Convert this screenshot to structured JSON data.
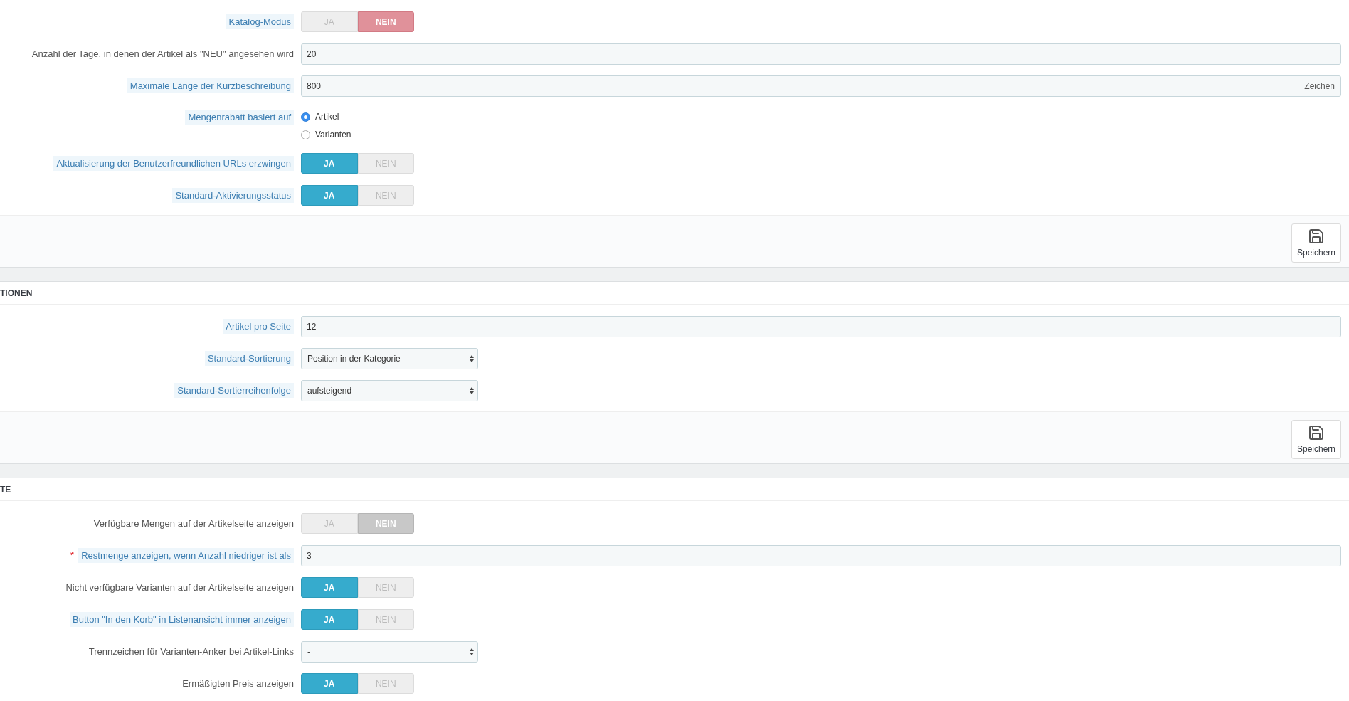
{
  "sections": [
    {
      "fields": [
        {
          "kind": "toggle",
          "label": "Katalog-Modus",
          "hint": true,
          "danger": true,
          "options": [
            {
              "label": "JA",
              "selected": false
            },
            {
              "label": "NEIN",
              "selected": true
            }
          ]
        },
        {
          "kind": "text",
          "label": "Anzahl der Tage, in denen der Artikel als \"NEU\" angesehen wird",
          "hint": false,
          "value": "20"
        },
        {
          "kind": "text",
          "label": "Maximale Länge der Kurzbeschreibung",
          "hint": true,
          "value": "800",
          "addon": "Zeichen"
        },
        {
          "kind": "radio",
          "label": "Mengenrabatt basiert auf",
          "hint": true,
          "options": [
            {
              "label": "Artikel",
              "selected": true
            },
            {
              "label": "Varianten",
              "selected": false
            }
          ]
        },
        {
          "kind": "toggle",
          "label": "Aktualisierung der Benutzerfreundlichen URLs erzwingen",
          "hint": true,
          "options": [
            {
              "label": "JA",
              "selected": true
            },
            {
              "label": "NEIN",
              "selected": false
            }
          ]
        },
        {
          "kind": "toggle",
          "label": "Standard-Aktivierungsstatus",
          "hint": true,
          "options": [
            {
              "label": "JA",
              "selected": true
            },
            {
              "label": "NEIN",
              "selected": false
            }
          ]
        }
      ],
      "save": "Speichern"
    },
    {
      "title": "TIONEN",
      "fields": [
        {
          "kind": "text",
          "label": "Artikel pro Seite",
          "hint": true,
          "value": "12"
        },
        {
          "kind": "select",
          "label": "Standard-Sortierung",
          "hint": true,
          "value": "Position in der Kategorie"
        },
        {
          "kind": "select",
          "label": "Standard-Sortierreihenfolge",
          "hint": true,
          "value": "aufsteigend"
        }
      ],
      "save": "Speichern"
    },
    {
      "title": "TE",
      "fields": [
        {
          "kind": "toggle",
          "label": "Verfügbare Mengen auf der Artikelseite anzeigen",
          "hint": false,
          "danger": false,
          "options": [
            {
              "label": "JA",
              "selected": false
            },
            {
              "label": "NEIN",
              "selected": true
            }
          ]
        },
        {
          "kind": "text",
          "label": "Restmenge anzeigen, wenn Anzahl niedriger ist als",
          "hint": true,
          "required_mark": "*",
          "value": "3"
        },
        {
          "kind": "toggle",
          "label": "Nicht verfügbare Varianten auf der Artikelseite anzeigen",
          "hint": false,
          "options": [
            {
              "label": "JA",
              "selected": true
            },
            {
              "label": "NEIN",
              "selected": false
            }
          ]
        },
        {
          "kind": "toggle",
          "label": "Button \"In den Korb\" in Listenansicht immer anzeigen",
          "hint": true,
          "options": [
            {
              "label": "JA",
              "selected": true
            },
            {
              "label": "NEIN",
              "selected": false
            }
          ]
        },
        {
          "kind": "select",
          "label": "Trennzeichen für Varianten-Anker bei Artikel-Links",
          "hint": false,
          "value": "-"
        },
        {
          "kind": "toggle",
          "label": "Ermäßigten Preis anzeigen",
          "hint": false,
          "options": [
            {
              "label": "JA",
              "selected": true
            },
            {
              "label": "NEIN",
              "selected": false
            }
          ]
        }
      ]
    }
  ]
}
